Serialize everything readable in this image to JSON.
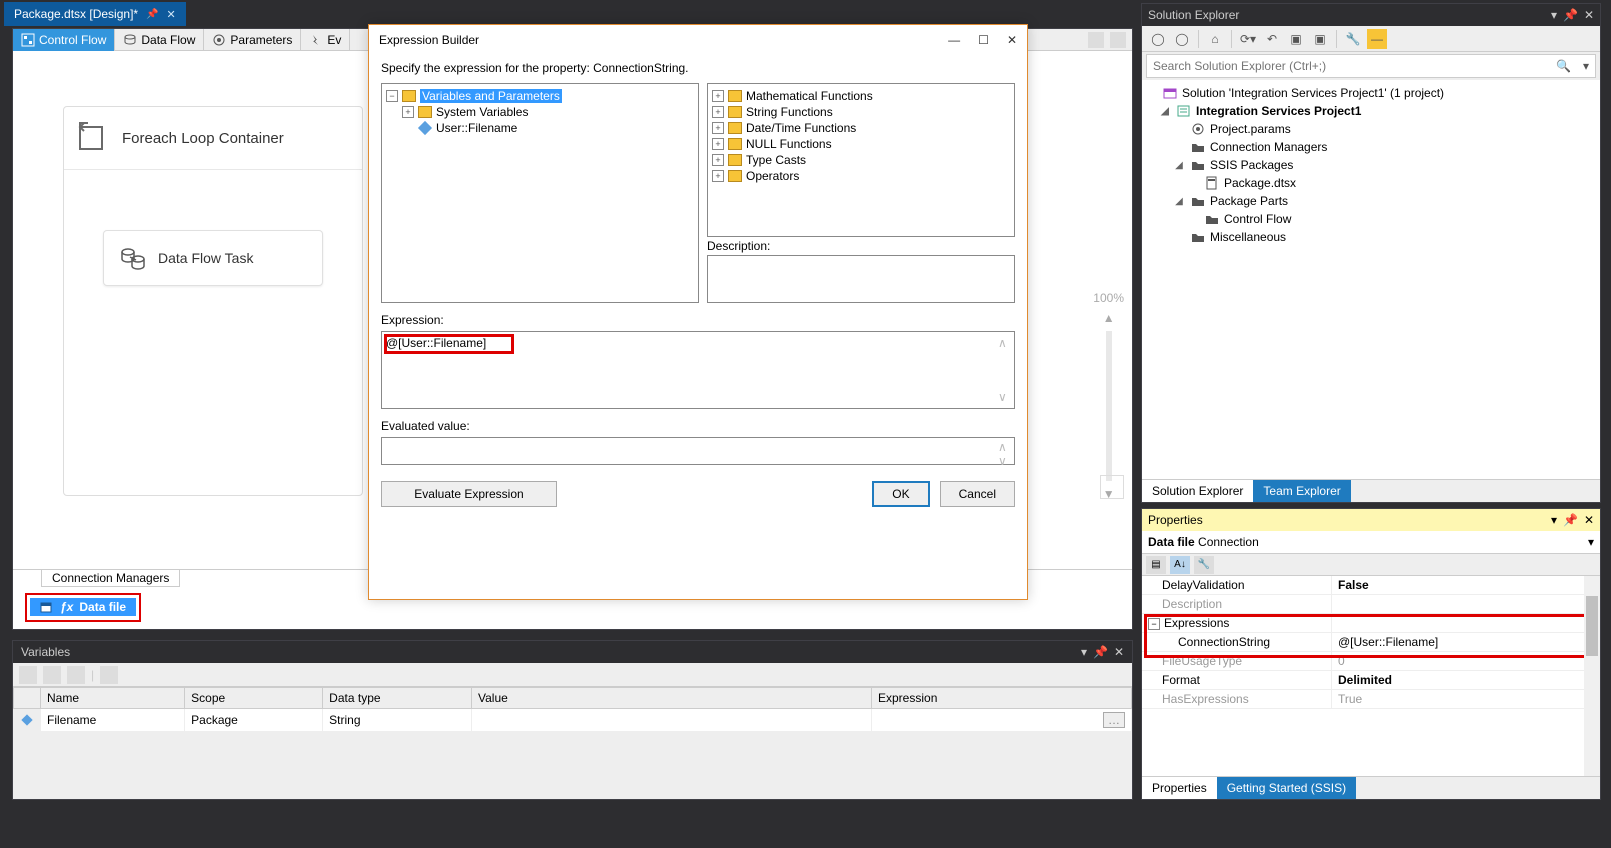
{
  "docTab": {
    "title": "Package.dtsx [Design]*"
  },
  "designerTabs": {
    "controlFlow": "Control Flow",
    "dataFlow": "Data Flow",
    "parameters": "Parameters",
    "eventHandlers": "Ev"
  },
  "canvas": {
    "foreachTitle": "Foreach Loop Container",
    "dftTitle": "Data Flow Task",
    "zoomLabel": "100%"
  },
  "connectionManagers": {
    "tabLabel": "Connection Managers",
    "item": "Data file"
  },
  "variablesPanel": {
    "title": "Variables",
    "cols": {
      "name": "Name",
      "scope": "Scope",
      "dataType": "Data type",
      "value": "Value",
      "expression": "Expression"
    },
    "row": {
      "name": "Filename",
      "scope": "Package",
      "dataType": "String",
      "value": "",
      "expression": ""
    }
  },
  "solutionExplorer": {
    "title": "Solution Explorer",
    "searchPlaceholder": "Search Solution Explorer (Ctrl+;)",
    "solution": "Solution 'Integration Services Project1' (1 project)",
    "project": "Integration Services Project1",
    "projectParams": "Project.params",
    "connManagers": "Connection Managers",
    "ssisPackages": "SSIS Packages",
    "packageDtsx": "Package.dtsx",
    "packageParts": "Package Parts",
    "controlFlow": "Control Flow",
    "misc": "Miscellaneous",
    "tabSolution": "Solution Explorer",
    "tabTeam": "Team Explorer"
  },
  "propertiesPanel": {
    "title": "Properties",
    "objName": "Data file",
    "objType": "Connection",
    "rows": {
      "delayValidation": {
        "k": "DelayValidation",
        "v": "False"
      },
      "description": {
        "k": "Description",
        "v": ""
      },
      "expressions": {
        "k": "Expressions",
        "v": ""
      },
      "connectionString": {
        "k": "ConnectionString",
        "v": "@[User::Filename]"
      },
      "fileUsageType": {
        "k": "FileUsageType",
        "v": "0"
      },
      "format": {
        "k": "Format",
        "v": "Delimited"
      },
      "hasExpressions": {
        "k": "HasExpressions",
        "v": "True"
      }
    },
    "tabProperties": "Properties",
    "tabGettingStarted": "Getting Started (SSIS)"
  },
  "dialog": {
    "title": "Expression Builder",
    "instruction": "Specify the expression for the property: ConnectionString.",
    "leftTree": {
      "varsParams": "Variables and Parameters",
      "systemVars": "System Variables",
      "userFilename": "User::Filename"
    },
    "rightTree": {
      "math": "Mathematical Functions",
      "string": "String Functions",
      "dateTime": "Date/Time Functions",
      "null": "NULL Functions",
      "typeCasts": "Type Casts",
      "operators": "Operators"
    },
    "descriptionLabel": "Description:",
    "expressionLabel": "Expression:",
    "expressionValue": "@[User::Filename]",
    "evaluatedLabel": "Evaluated value:",
    "evaluateBtn": "Evaluate Expression",
    "okBtn": "OK",
    "cancelBtn": "Cancel"
  }
}
